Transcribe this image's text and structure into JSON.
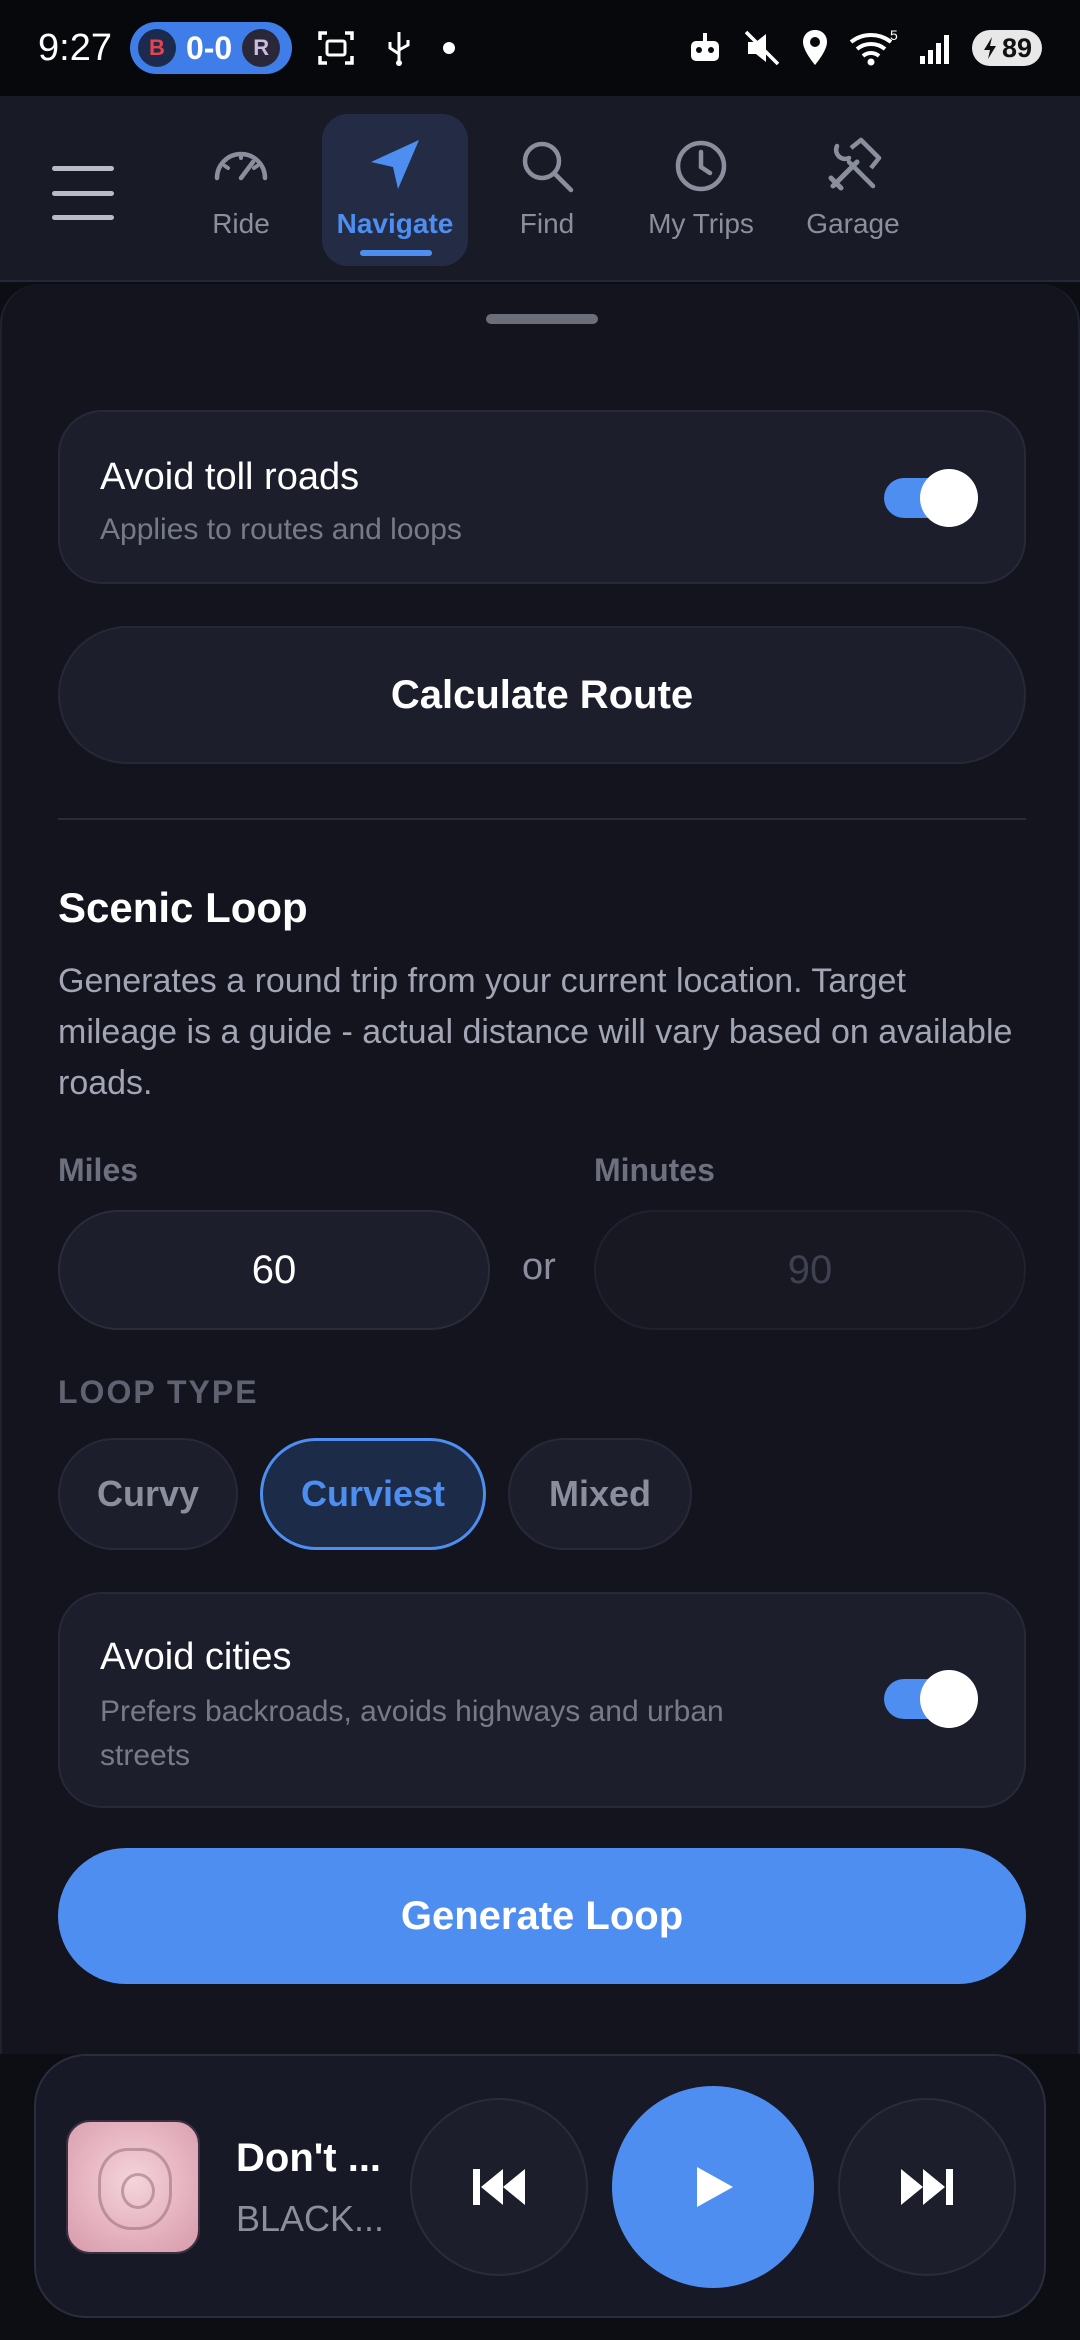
{
  "status_bar": {
    "time": "9:27",
    "score": "0-0",
    "team_home": "B",
    "team_away": "R",
    "signal_label": "5",
    "battery": "89"
  },
  "nav": {
    "tabs": [
      {
        "label": "Ride",
        "icon": "speedometer-icon"
      },
      {
        "label": "Navigate",
        "icon": "navigation-arrow-icon"
      },
      {
        "label": "Find",
        "icon": "search-icon"
      },
      {
        "label": "My Trips",
        "icon": "clock-icon"
      },
      {
        "label": "Garage",
        "icon": "tools-icon"
      }
    ],
    "active_tab": "Navigate"
  },
  "route": {
    "avoid_tolls_title": "Avoid toll roads",
    "avoid_tolls_sub": "Applies to routes and loops",
    "avoid_tolls_on": true,
    "calculate_label": "Calculate Route"
  },
  "scenic_loop": {
    "title": "Scenic Loop",
    "description": "Generates a round trip from your current location. Target mileage is a guide - actual distance will vary based on available roads.",
    "miles_label": "Miles",
    "miles_value": "60",
    "or_label": "or",
    "minutes_label": "Minutes",
    "minutes_placeholder": "90",
    "loop_type_label": "LOOP TYPE",
    "loop_types": [
      "Curvy",
      "Curviest",
      "Mixed"
    ],
    "selected_loop_type": "Curviest",
    "avoid_cities_title": "Avoid cities",
    "avoid_cities_sub": "Prefers backroads, avoids highways and urban streets",
    "avoid_cities_on": true,
    "generate_label": "Generate Loop"
  },
  "player": {
    "title": "Don't ...",
    "artist": "BLACK...",
    "playing": false
  },
  "colors": {
    "accent": "#4d8ef0",
    "background": "#13141d",
    "card": "#1d1e2c"
  }
}
